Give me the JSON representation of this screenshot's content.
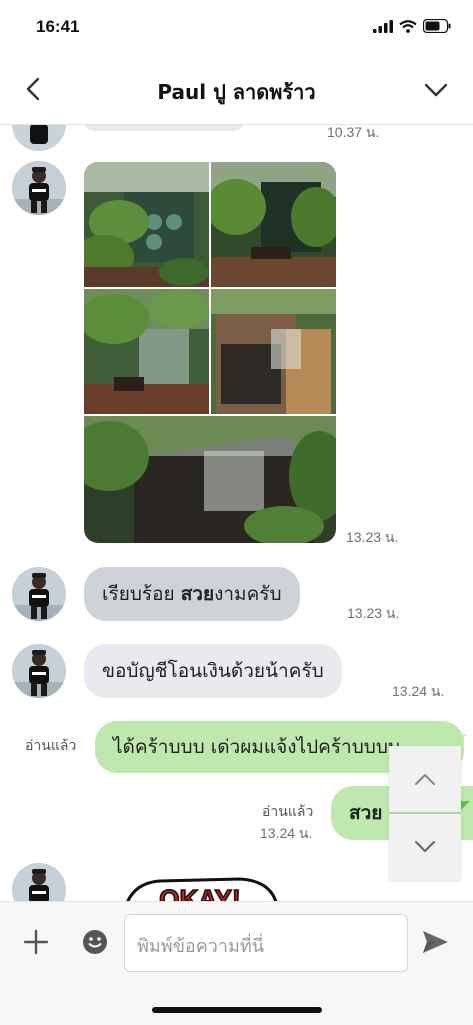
{
  "status": {
    "time": "16:41"
  },
  "header": {
    "title": "Paul ปู ลาดพร้าว"
  },
  "messages": {
    "first_partial_time": "10.37 น.",
    "photo_time": "13.23 น.",
    "msg1": {
      "text_prefix": "เรียบร้อย ",
      "text_bold": "สวย",
      "text_suffix": "งามครับ",
      "time": "13.23 น."
    },
    "msg2": {
      "text": "ขอบัญชีโอนเงินด้วยน้าครับ",
      "time": "13.24 น."
    },
    "msg3": {
      "read": "อ่านแล้ว",
      "text": "ได้คร้าบบบ เด่วผมแจ้งไปคร้าบบบบ"
    },
    "msg4": {
      "read": "อ่านแล้ว",
      "time": "13.24 น.",
      "text": "สวย"
    },
    "sticker_text": "OKAY!"
  },
  "input": {
    "placeholder": "พิมพ์ข้อความที่นี่"
  },
  "colors": {
    "green_bubble": "#bfe8ae",
    "gray_bubble": "#e9eaee",
    "accent_green": "#5cc14e"
  }
}
